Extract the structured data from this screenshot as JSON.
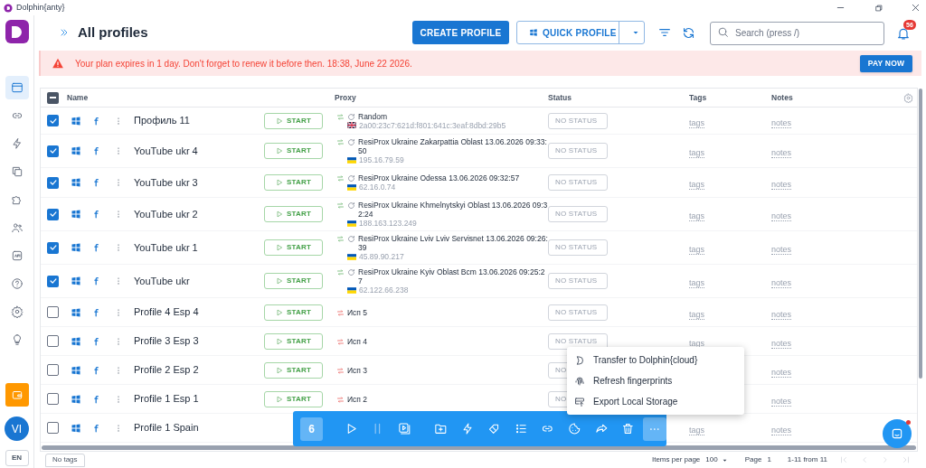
{
  "window": {
    "title": "Dolphin{anty}"
  },
  "sidebar": {
    "items": [
      {
        "selected": true
      },
      {
        "selected": false
      },
      {
        "selected": false
      },
      {
        "selected": false
      },
      {
        "selected": false
      },
      {
        "selected": false
      },
      {
        "selected": false
      },
      {
        "selected": false
      },
      {
        "selected": false
      },
      {
        "selected": false
      }
    ],
    "avatar": "VI",
    "language": "EN"
  },
  "header": {
    "title": "All profiles",
    "create_button": "CREATE PROFILE",
    "quick_button": "QUICK PROFILE",
    "search": {
      "placeholder": "Search (press /)"
    },
    "notifications": "56"
  },
  "banner": {
    "message": "Your plan expires in 1 day. Don't forget to renew it before then. 18:38, June 22 2026.",
    "button": "PAY NOW"
  },
  "table": {
    "select_all": {
      "indeterminate": true
    },
    "columns": [
      "Name",
      "Proxy",
      "Status",
      "Tags",
      "Notes"
    ],
    "rows": [
      {
        "checked": true,
        "name": "Профиль 11",
        "start": "START",
        "proxy": {
          "kind": "rotating",
          "name": "Random",
          "flag": {
            "kind": "uk"
          },
          "ip": "2a00:23c7:621d:f801:641c:3eaf:8dbd:29b5"
        },
        "status": "NO STATUS",
        "tags": "tags",
        "notes": "notes"
      },
      {
        "checked": true,
        "name": "YouTube ukr 4",
        "start": "START",
        "proxy": {
          "kind": "rotating",
          "name": "ResiProx Ukraine Zakarpattia Oblast 13.06.2026 09:33:50",
          "flag": {
            "kind": "ua"
          },
          "ip": "195.16.79.59"
        },
        "status": "NO STATUS",
        "tags": "tags",
        "notes": "notes"
      },
      {
        "checked": true,
        "name": "YouTube ukr 3",
        "start": "START",
        "proxy": {
          "kind": "rotating",
          "name": "ResiProx Ukraine Odessa 13.06.2026 09:32:57",
          "flag": {
            "kind": "ua"
          },
          "ip": "62.16.0.74"
        },
        "status": "NO STATUS",
        "tags": "tags",
        "notes": "notes"
      },
      {
        "checked": true,
        "name": "YouTube ukr 2",
        "start": "START",
        "proxy": {
          "kind": "rotating",
          "name": "ResiProx Ukraine Khmelnytskyi Oblast 13.06.2026 09:32:24",
          "flag": {
            "kind": "ua"
          },
          "ip": "188.163.123.249"
        },
        "status": "NO STATUS",
        "tags": "tags",
        "notes": "notes"
      },
      {
        "checked": true,
        "name": "YouTube ukr 1",
        "start": "START",
        "proxy": {
          "kind": "rotating",
          "name": "ResiProx Ukraine Lviv Lviv Servisnet 13.06.2026 09:26:39",
          "flag": {
            "kind": "ua"
          },
          "ip": "45.89.90.217"
        },
        "status": "NO STATUS",
        "tags": "tags",
        "notes": "notes"
      },
      {
        "checked": true,
        "name": "YouTube ukr",
        "start": "START",
        "proxy": {
          "kind": "rotating",
          "name": "ResiProx Ukraine Kyiv Oblast Bcm 13.06.2026 09:25:27",
          "flag": {
            "kind": "ua"
          },
          "ip": "62.122.66.238"
        },
        "status": "NO STATUS",
        "tags": "tags",
        "notes": "notes"
      },
      {
        "checked": false,
        "name": "Profile 4 Esp 4",
        "start": "START",
        "proxy": {
          "kind": "static",
          "name": "Исп 5"
        },
        "status": "NO STATUS",
        "tags": "tags",
        "notes": "notes"
      },
      {
        "checked": false,
        "name": "Profile 3 Esp 3",
        "start": "START",
        "proxy": {
          "kind": "static",
          "name": "Исп 4"
        },
        "status": "NO STATUS",
        "tags": "tags",
        "notes": "notes"
      },
      {
        "checked": false,
        "name": "Profile 2 Esp 2",
        "start": "START",
        "proxy": {
          "kind": "static",
          "name": "Исп 3"
        },
        "status": "NO",
        "notes": "notes"
      },
      {
        "checked": false,
        "name": "Profile 1 Esp 1",
        "start": "START",
        "proxy": {
          "kind": "static",
          "name": "Исп 2"
        },
        "status": "NO",
        "notes": "notes"
      },
      {
        "checked": false,
        "name": "Profile 1 Spain",
        "tags": "tags",
        "notes": "notes"
      }
    ]
  },
  "selection_bar": {
    "count": "6",
    "actions": [
      {
        "disabled": false,
        "selected": false
      },
      {
        "disabled": true,
        "selected": false
      },
      {
        "disabled": false,
        "selected": false
      },
      {
        "disabled": false,
        "selected": false
      },
      {
        "disabled": false,
        "selected": false
      },
      {
        "disabled": false,
        "selected": false
      },
      {
        "disabled": false,
        "selected": false
      },
      {
        "disabled": false,
        "selected": false
      },
      {
        "disabled": false,
        "selected": false
      },
      {
        "disabled": false,
        "selected": false
      },
      {
        "disabled": false,
        "selected": false
      },
      {
        "disabled": false,
        "selected": true
      }
    ]
  },
  "menu": {
    "items": [
      "Transfer to Dolphin{cloud}",
      "Refresh fingerprints",
      "Export Local Storage"
    ]
  },
  "footer": {
    "tag": "No tags",
    "items_per_page_label": "Items per page",
    "items_per_page": "100",
    "page_label": "Page",
    "page": "1",
    "range": "1-11 from 11"
  }
}
